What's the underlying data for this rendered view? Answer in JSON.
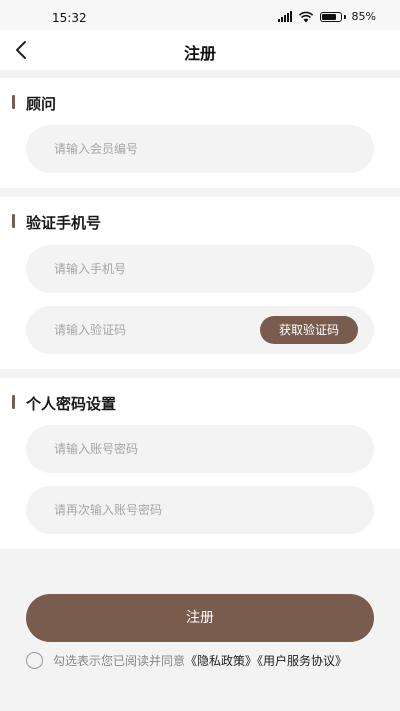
{
  "status_bar": {
    "time": "15:32",
    "battery_percent": "85%",
    "battery_level": 0.85,
    "icons": [
      "hd-icon",
      "signal-icon",
      "wifi-icon",
      "battery-icon"
    ]
  },
  "nav": {
    "back_icon": "chevron-left-icon",
    "title": "注册"
  },
  "sections": {
    "advisor": {
      "title": "顾问",
      "field_placeholder": "请输入会员编号"
    },
    "phone": {
      "title": "验证手机号",
      "phone_placeholder": "请输入手机号",
      "code_placeholder": "请输入验证码",
      "code_button": "获取验证码"
    },
    "password": {
      "title": "个人密码设置",
      "password_placeholder": "请输入账号密码",
      "confirm_placeholder": "请再次输入账号密码"
    }
  },
  "submit_label": "注册",
  "agreement": {
    "text": "勾选表示您已阅读并同意",
    "privacy_link": "《隐私政策》",
    "service_link": "《用户服务协议》"
  },
  "colors": {
    "accent": "#7a5c4e",
    "field_bg": "#f3f3f3",
    "page_bg": "#f3f3f3"
  }
}
